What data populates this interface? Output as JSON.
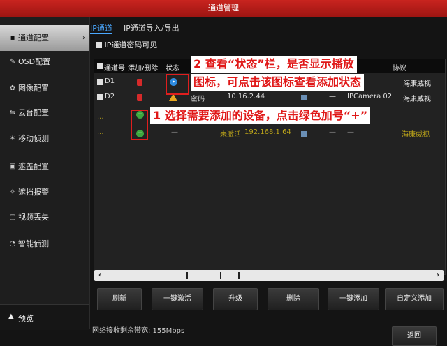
{
  "window": {
    "title": "通道管理"
  },
  "sidebar": {
    "items": [
      {
        "label": "通道配置",
        "icon": "camera-icon",
        "glyph": "▪",
        "active": true
      },
      {
        "label": "OSD配置",
        "icon": "brush-icon",
        "glyph": "✎"
      },
      {
        "label": "图像配置",
        "icon": "image-settings-icon",
        "glyph": "✿"
      },
      {
        "label": "云台配置",
        "icon": "ptz-icon",
        "glyph": "⇋"
      },
      {
        "label": "移动侦测",
        "icon": "motion-icon",
        "glyph": "✶"
      },
      {
        "label": "遮盖配置",
        "icon": "privacy-mask-icon",
        "glyph": "▣"
      },
      {
        "label": "遮挡报警",
        "icon": "tamper-alarm-icon",
        "glyph": "✧"
      },
      {
        "label": "视频丢失",
        "icon": "video-loss-icon",
        "glyph": "▢"
      },
      {
        "label": "智能侦测",
        "icon": "smart-detect-icon",
        "glyph": "◔"
      }
    ],
    "arrow": "›",
    "preview_label": "预览"
  },
  "tabs": [
    {
      "label": "IP通道",
      "active": true
    },
    {
      "label": "IP通道导入/导出",
      "active": false
    }
  ],
  "password_visible_label": "IP通道密码可见",
  "table": {
    "headers": {
      "channel": "通道号",
      "add_delete": "添加/删除",
      "status": "状态",
      "protocol_partial": "协议"
    },
    "rows": [
      {
        "channel": "D1",
        "protocol": "海康威视",
        "status_icon": "play-icon"
      },
      {
        "channel": "D2",
        "status_text": "密码",
        "ip": "10.16.2.44",
        "device": "IPCamera 02",
        "protocol": "海康威视",
        "status_icon": "warning-icon"
      },
      {
        "channel": "...",
        "status_icon": "plus-icon"
      },
      {
        "channel": "...",
        "dash": "—",
        "status_text": "未激活",
        "ip": "192.168.1.64",
        "extra1": "—",
        "extra2": "—",
        "protocol": "海康威视",
        "status_icon": "plus-icon"
      }
    ]
  },
  "annotations": {
    "callout_2_line1": "2 查看“状态”栏，是否显示播放",
    "callout_2_line2": "图标，可点击该图标查看添加状态",
    "callout_1": "1 选择需要添加的设备，点击绿色加号“+”"
  },
  "buttons": {
    "refresh": "刷新",
    "one_click_activate": "一键激活",
    "upgrade": "升级",
    "delete": "删除",
    "one_click_add": "一键添加",
    "custom_add": "自定义添加",
    "back": "返回"
  },
  "bandwidth_text": "网络接收剩余带宽: 155Mbps",
  "colors": {
    "title_bar": "#b81d19",
    "accent": "#4aa8ff",
    "callout_red": "#e01818",
    "unactivated_yellow": "#b9a21a"
  }
}
